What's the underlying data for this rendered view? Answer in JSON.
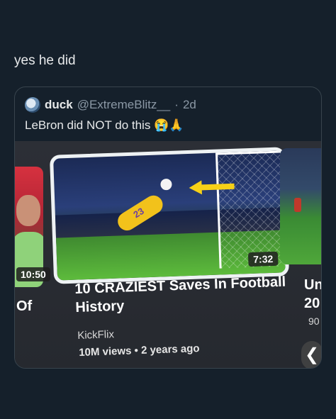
{
  "post": {
    "text": "yes he did"
  },
  "quote": {
    "name": "duck",
    "handle": "@ExtremeBlitz__",
    "separator": "·",
    "time": "2d",
    "text": "LeBron did NOT do this",
    "emojis": "😭🙏"
  },
  "video": {
    "title": "10 CRAZIEST Saves In Football History",
    "channel": "KickFlix",
    "meta": "10M views • 2 years ago",
    "duration": "7:32",
    "jersey_number": "23"
  },
  "side_left": {
    "duration": "10:50",
    "title_fragment": "Of"
  },
  "side_right": {
    "title_line1": "Unl",
    "title_line2": "20",
    "views_fragment": "90"
  },
  "icons": {
    "scroll_back": "chevron-left-icon",
    "avatar": "avatar-icon",
    "arrow": "arrow-left-icon"
  },
  "colors": {
    "background": "#15202b",
    "text": "#e7e9ea",
    "muted": "#8b98a5",
    "arrow": "#f7d117"
  }
}
